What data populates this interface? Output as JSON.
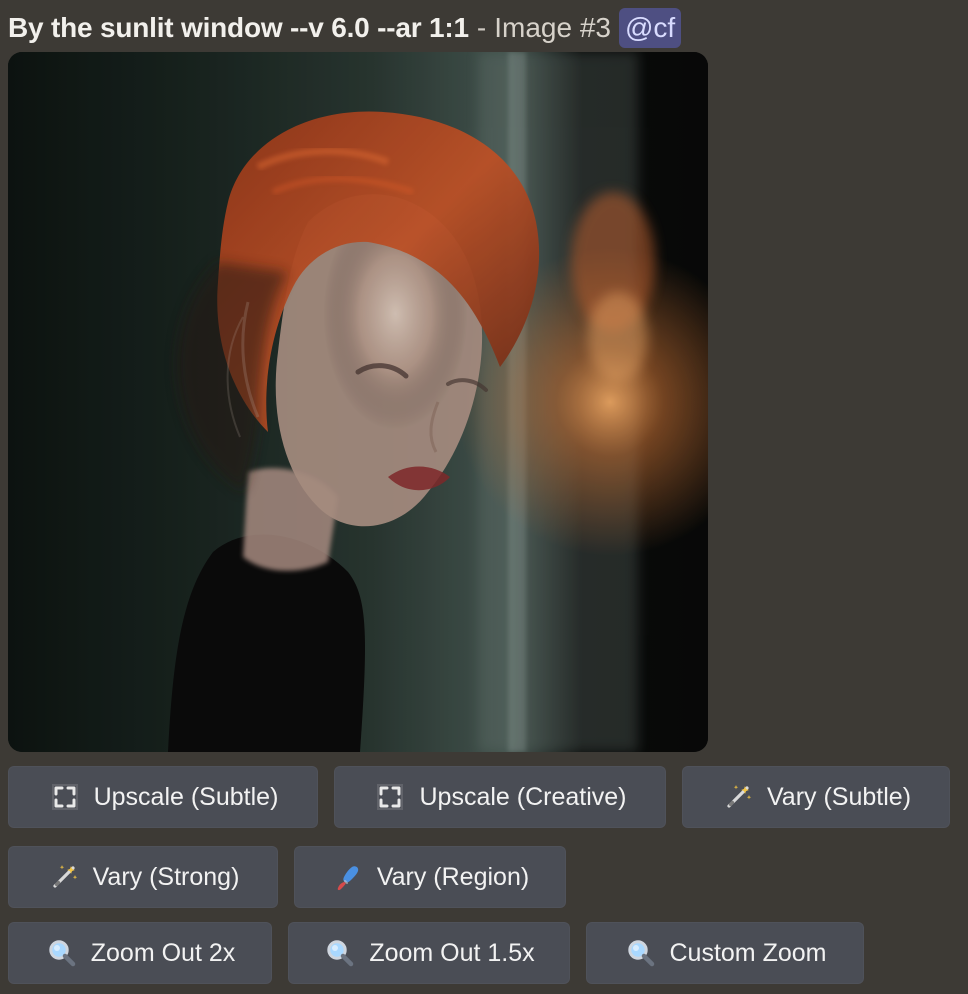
{
  "message": {
    "prompt": "By the sunlit window --v 6.0 --ar 1:1",
    "separator": "-",
    "image_number_label": "Image #3",
    "mention": "@cf"
  },
  "buttons": {
    "row1": [
      {
        "label": "Upscale (Subtle)",
        "icon": "upscale-icon"
      },
      {
        "label": "Upscale (Creative)",
        "icon": "upscale-icon"
      },
      {
        "label": "Vary (Subtle)",
        "icon": "magic-wand-icon"
      }
    ],
    "row2": [
      {
        "label": "Vary (Strong)",
        "icon": "magic-wand-icon"
      },
      {
        "label": "Vary (Region)",
        "icon": "paintbrush-icon"
      }
    ],
    "row3": [
      {
        "label": "Zoom Out 2x",
        "icon": "magnifying-glass-icon"
      },
      {
        "label": "Zoom Out 1.5x",
        "icon": "magnifying-glass-icon"
      },
      {
        "label": "Custom Zoom",
        "icon": "magnifying-glass-icon"
      }
    ]
  },
  "colors": {
    "background": "#3d3a35",
    "button_bg": "#4a4d55",
    "mention_bg": "#4e4f82"
  }
}
